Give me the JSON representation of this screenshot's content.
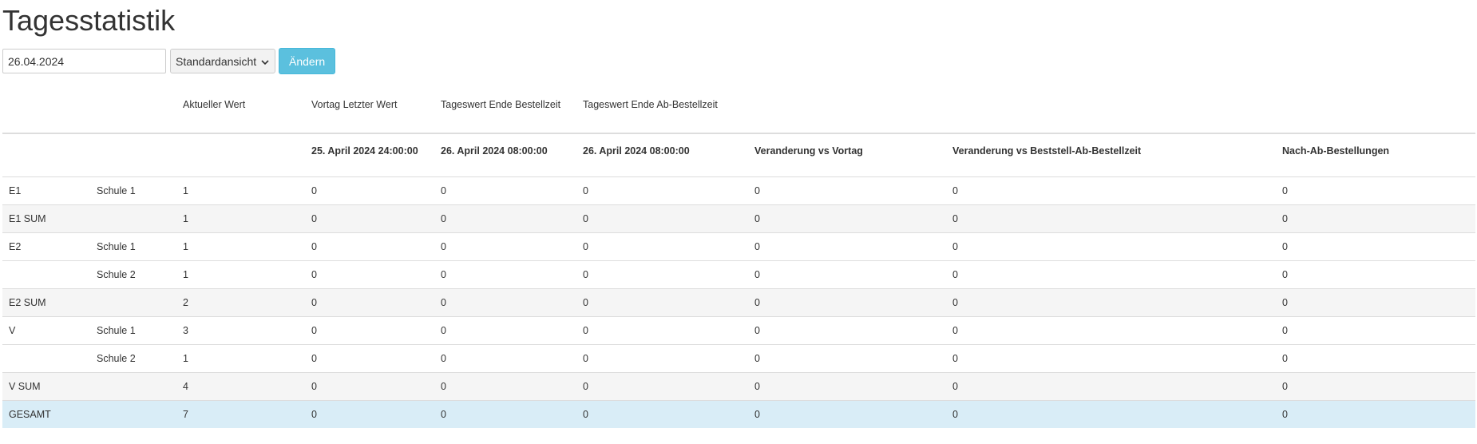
{
  "page": {
    "title": "Tagesstatistik"
  },
  "filter": {
    "date_value": "26.04.2024",
    "view_selected": "Standardansicht",
    "submit_label": "Ändern"
  },
  "table": {
    "header_top": [
      "",
      "",
      "Aktueller Wert",
      "Vortag Letzter Wert",
      "Tageswert Ende Bestellzeit",
      "Tageswert Ende Ab-Bestellzeit",
      "",
      "",
      ""
    ],
    "header_sub": [
      "",
      "",
      "",
      "25. April 2024 24:00:00",
      "26. April 2024 08:00:00",
      "26. April 2024 08:00:00",
      "Veranderung vs Vortag",
      "Veranderung vs Beststell-Ab-Bestellzeit",
      "Nach-Ab-Bestellungen"
    ],
    "rows": [
      {
        "type": "normal",
        "cells": [
          "E1",
          "Schule 1",
          "1",
          "0",
          "0",
          "0",
          "0",
          "0",
          "0"
        ]
      },
      {
        "type": "sum",
        "cells": [
          "E1 SUM",
          "",
          "1",
          "0",
          "0",
          "0",
          "0",
          "0",
          "0"
        ]
      },
      {
        "type": "normal",
        "cells": [
          "E2",
          "Schule 1",
          "1",
          "0",
          "0",
          "0",
          "0",
          "0",
          "0"
        ]
      },
      {
        "type": "normal",
        "cells": [
          "",
          "Schule 2",
          "1",
          "0",
          "0",
          "0",
          "0",
          "0",
          "0"
        ]
      },
      {
        "type": "sum",
        "cells": [
          "E2 SUM",
          "",
          "2",
          "0",
          "0",
          "0",
          "0",
          "0",
          "0"
        ]
      },
      {
        "type": "normal",
        "cells": [
          "V",
          "Schule 1",
          "3",
          "0",
          "0",
          "0",
          "0",
          "0",
          "0"
        ]
      },
      {
        "type": "normal",
        "cells": [
          "",
          "Schule 2",
          "1",
          "0",
          "0",
          "0",
          "0",
          "0",
          "0"
        ]
      },
      {
        "type": "sum",
        "cells": [
          "V SUM",
          "",
          "4",
          "0",
          "0",
          "0",
          "0",
          "0",
          "0"
        ]
      },
      {
        "type": "total",
        "cells": [
          "GESAMT",
          "",
          "7",
          "0",
          "0",
          "0",
          "0",
          "0",
          "0"
        ]
      }
    ]
  },
  "colors": {
    "accent": "#5bc0de",
    "sum_row": "#f5f5f5",
    "total_row": "#d9edf7"
  },
  "icons": {
    "select_chevron": "chevron-down-icon"
  }
}
